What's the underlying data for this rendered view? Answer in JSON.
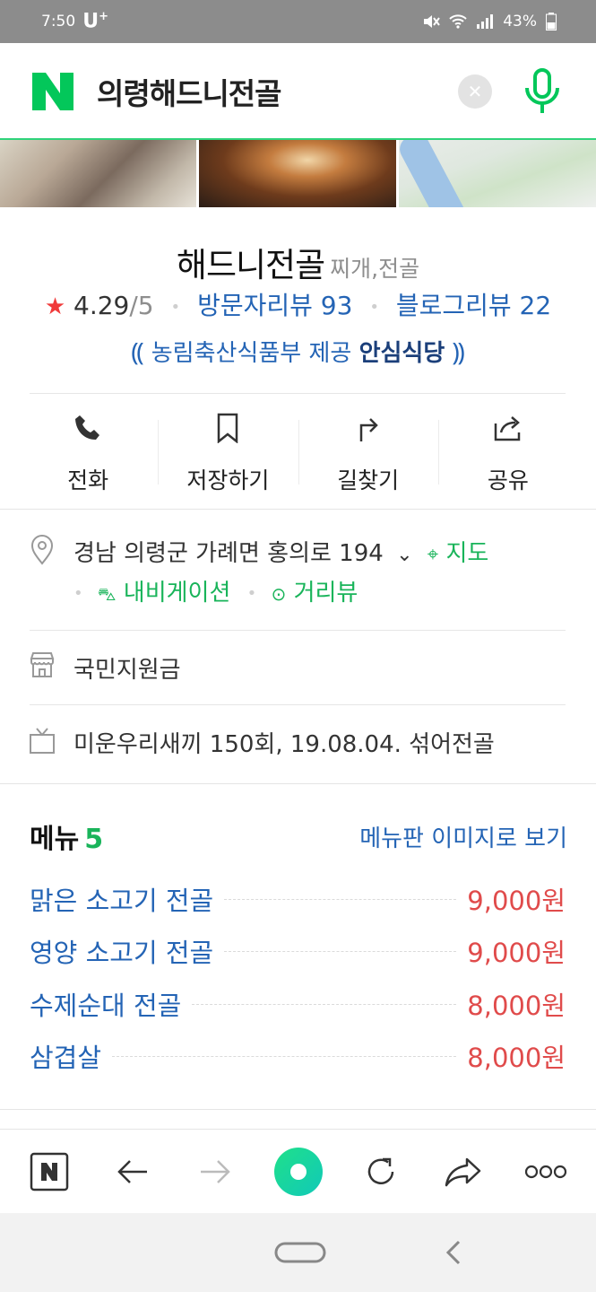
{
  "status_bar": {
    "time": "7:50",
    "carrier": "U",
    "carrier_sup": "+",
    "battery": "43%"
  },
  "search": {
    "query": "의령해드니전골",
    "clear_symbol": "✕"
  },
  "place": {
    "name": "해드니전골",
    "category": "찌개,전골",
    "rating": "4.29",
    "rating_total": "/5",
    "visitor_reviews": "방문자리뷰 93",
    "blog_reviews": "블로그리뷰 22",
    "cert_text": "농림축산식품부 제공",
    "cert_strong": "안심식당"
  },
  "actions": [
    {
      "label": "전화",
      "icon": "phone-icon"
    },
    {
      "label": "저장하기",
      "icon": "bookmark-icon"
    },
    {
      "label": "길찾기",
      "icon": "directions-icon"
    },
    {
      "label": "공유",
      "icon": "share-icon"
    }
  ],
  "info": {
    "address": "경남 의령군 가례면 홍의로 194",
    "map_label": "지도",
    "navigation_label": "내비게이션",
    "streetview_label": "거리뷰",
    "support_label": "국민지원금",
    "tv_label": "미운우리새끼 150회, 19.08.04. 섞어전골"
  },
  "menu": {
    "title": "메뉴",
    "count": "5",
    "image_link": "메뉴판 이미지로 보기",
    "items": [
      {
        "name": "맑은 소고기 전골",
        "price": "9,000원"
      },
      {
        "name": "영양 소고기 전골",
        "price": "9,000원"
      },
      {
        "name": "수제순대 전골",
        "price": "8,000원"
      },
      {
        "name": "삼겹살",
        "price": "8,000원"
      }
    ]
  },
  "colors": {
    "naver_green": "#03C75A",
    "link_blue": "#2464B5",
    "price_red": "#E04B4B",
    "star_red": "#F03A3A"
  }
}
